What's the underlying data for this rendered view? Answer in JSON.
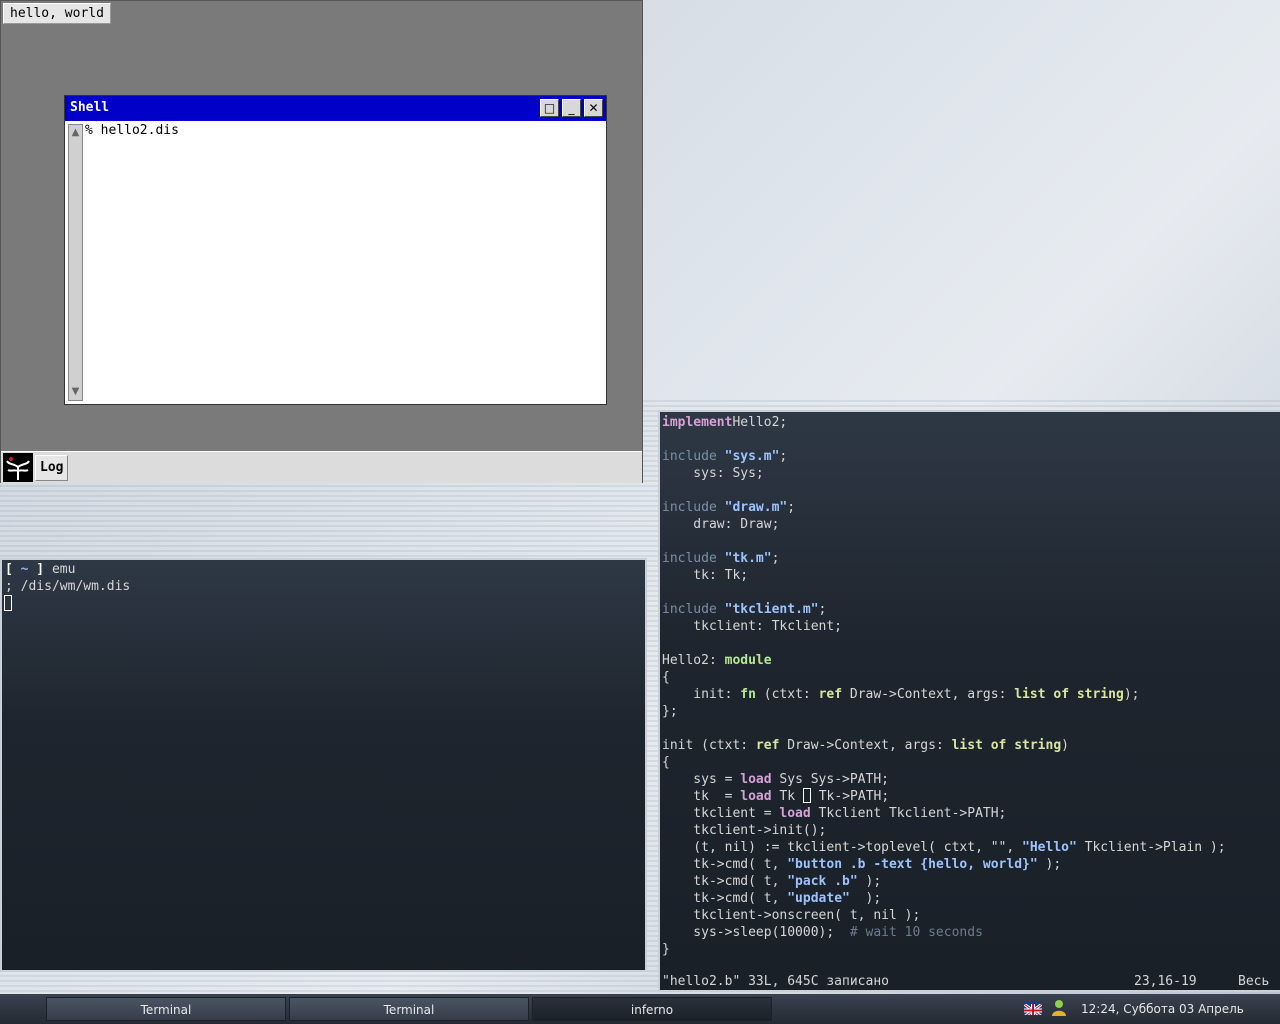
{
  "inferno": {
    "hello_button": "hello, world",
    "shell": {
      "title": "Shell",
      "maximize": "□",
      "minimize": "_",
      "close": "✕",
      "content": "% hello2.dis"
    },
    "log_button": "Log"
  },
  "terminal1": {
    "prompt_open": "[ ",
    "prompt_dir": "~",
    "prompt_close": " ]",
    "prompt_cmd": " emu",
    "line2": "; /dis/wm/wm.dis"
  },
  "vim": {
    "lines": [
      [
        [
          "kw",
          "implement"
        ],
        [
          "",
          "Hello2;"
        ]
      ],
      [],
      [
        [
          "inc",
          "include "
        ],
        [
          "str",
          "\"sys.m\""
        ],
        [
          "",
          ";"
        ]
      ],
      [
        [
          "",
          "    sys: Sys;"
        ]
      ],
      [],
      [
        [
          "inc",
          "include "
        ],
        [
          "str",
          "\"draw.m\""
        ],
        [
          "",
          ";"
        ]
      ],
      [
        [
          "",
          "    draw: Draw;"
        ]
      ],
      [],
      [
        [
          "inc",
          "include "
        ],
        [
          "str",
          "\"tk.m\""
        ],
        [
          "",
          ";"
        ]
      ],
      [
        [
          "",
          "    tk: Tk;"
        ]
      ],
      [],
      [
        [
          "inc",
          "include "
        ],
        [
          "str",
          "\"tkclient.m\""
        ],
        [
          "",
          ";"
        ]
      ],
      [
        [
          "",
          "    tkclient: Tkclient;"
        ]
      ],
      [],
      [
        [
          "",
          "Hello2: "
        ],
        [
          "grn",
          "module"
        ]
      ],
      [
        [
          "",
          "{"
        ]
      ],
      [
        [
          "",
          "    init: "
        ],
        [
          "grn",
          "fn"
        ],
        [
          "",
          ", (ctxt: "
        ],
        [
          "typ",
          "ref"
        ],
        [
          "",
          ", Draw->Context, args: "
        ],
        [
          "typ",
          "list of string"
        ],
        [
          "",
          ");"
        ]
      ],
      [
        [
          "",
          "};"
        ]
      ],
      [],
      [
        [
          "",
          "init (ctxt: "
        ],
        [
          "typ",
          "ref"
        ],
        [
          "",
          ", Draw->Context, args: "
        ],
        [
          "typ",
          "list of string"
        ],
        [
          "",
          ")"
        ]
      ],
      [
        [
          "",
          "{"
        ]
      ],
      [
        [
          "",
          "    sys = "
        ],
        [
          "kw",
          "load"
        ],
        [
          "",
          ", Sys Sys->PATH;"
        ]
      ],
      [
        [
          "",
          "    tk  = "
        ],
        [
          "kw",
          "load"
        ],
        [
          "",
          ", Tk "
        ],
        [
          "cursor",
          ""
        ],
        [
          "",
          ", Tk->PATH;"
        ]
      ],
      [
        [
          "",
          "    tkclient = "
        ],
        [
          "kw",
          "load"
        ],
        [
          "",
          ", Tkclient Tkclient->PATH;"
        ]
      ],
      [
        [
          "",
          "    tkclient->init();"
        ]
      ],
      [
        [
          "",
          "    (t, nil) := tkclient->toplevel( ctxt, \"\", "
        ],
        [
          "str",
          "\"Hello\""
        ],
        [
          "",
          ", Tkclient->Plain );"
        ]
      ],
      [
        [
          "",
          "    tk->cmd( t, "
        ],
        [
          "str",
          "\"button .b -text {hello, world}\""
        ],
        [
          "",
          ", );"
        ]
      ],
      [
        [
          "",
          "    tk->cmd( t, "
        ],
        [
          "str",
          "\"pack .b\""
        ],
        [
          "",
          ", );"
        ]
      ],
      [
        [
          "",
          "    tk->cmd( t, "
        ],
        [
          "str",
          "\"update\""
        ],
        [
          "",
          ",  );"
        ]
      ],
      [
        [
          "",
          "    tkclient->onscreen( t, nil );"
        ]
      ],
      [
        [
          "",
          "    sys->sleep(10000);  "
        ],
        [
          "cmt",
          "# wait 10 seconds"
        ]
      ],
      [
        [
          "",
          "}"
        ]
      ]
    ],
    "status_file": "\"hello2.b\" 33L, 645C записано",
    "status_pos": "23,16-19",
    "status_all": "Весь"
  },
  "taskbar": {
    "tasks": [
      "Terminal",
      "Terminal",
      "inferno"
    ],
    "clock": "12:24, Суббота 03 Апрель"
  },
  "colors": {
    "shell_title": "#0000c8",
    "terminal_bg": "#1e252e"
  }
}
